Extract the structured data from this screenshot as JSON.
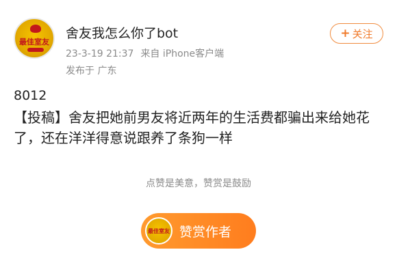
{
  "author": {
    "name": "舍友我怎么你了bot",
    "avatar_text": "最佳室友",
    "timestamp": "23-3-19 21:37",
    "source": "来自 iPhone客户端",
    "location": "发布于 广东"
  },
  "follow_button": {
    "icon": "plus-icon",
    "icon_glyph": "+",
    "label": "关注",
    "color": "#f07a2a"
  },
  "post": {
    "number": "8012",
    "text": "【投稿】舍友把她前男友将近两年的生活费都骗出来给她花了，还在洋洋得意说跟养了条狗一样"
  },
  "reward": {
    "tip": "点赞是美意，赞赏是鼓励",
    "button_label": "赞赏作者",
    "button_color": "#ff8a25"
  }
}
